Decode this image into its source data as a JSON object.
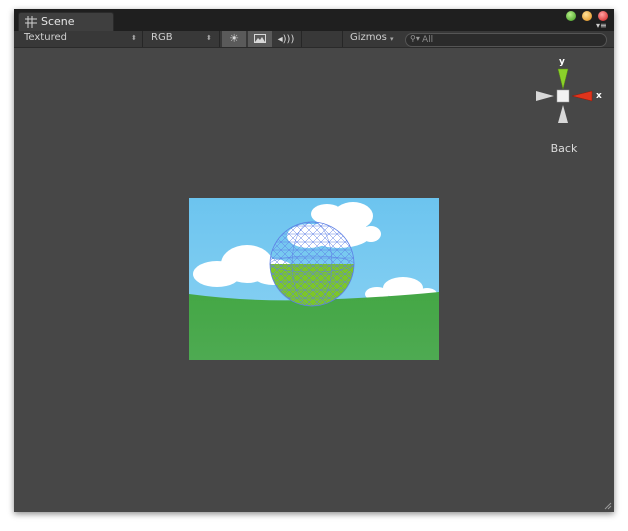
{
  "tab": {
    "label": "Scene",
    "icon": "grid-icon"
  },
  "window_controls": [
    "minimize-button",
    "maximize-button",
    "close-button"
  ],
  "toolbar": {
    "render_mode": "Textured",
    "channel": "RGB",
    "lighting_icon": "sun-icon",
    "skybox_icon": "image-icon",
    "audio_icon": "speaker-icon",
    "gizmos_label": "Gizmos",
    "search_placeholder": "All"
  },
  "gizmo": {
    "y_label": "y",
    "x_label": "x",
    "view_label": "Back"
  },
  "colors": {
    "window_bg": "#474747",
    "sky": "#6ec3ef",
    "grass": "#4aa94a",
    "sphere_wire": "#6a8ff0"
  }
}
